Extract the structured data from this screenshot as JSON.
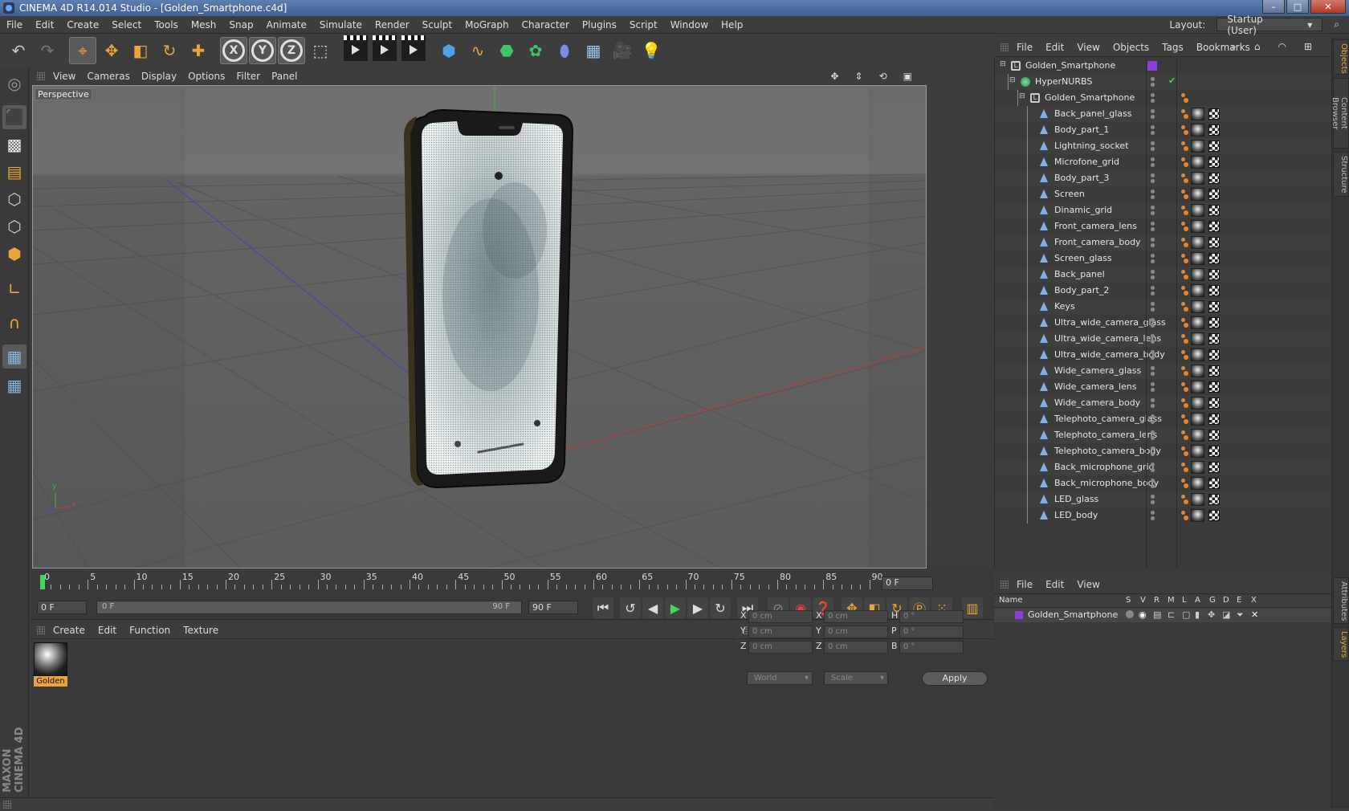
{
  "window": {
    "title": "CINEMA 4D R14.014 Studio - [Golden_Smartphone.c4d]",
    "min": "–",
    "max": "□",
    "close": "✕"
  },
  "menubar": {
    "items": [
      "File",
      "Edit",
      "Create",
      "Select",
      "Tools",
      "Mesh",
      "Snap",
      "Animate",
      "Simulate",
      "Render",
      "Sculpt",
      "MoGraph",
      "Character",
      "Plugins",
      "Script",
      "Window",
      "Help"
    ],
    "layout_label": "Layout:",
    "layout_value": "Startup (User)"
  },
  "toolbar": {
    "axis_x": "X",
    "axis_y": "Y",
    "axis_z": "Z"
  },
  "viewport": {
    "menu": [
      "View",
      "Cameras",
      "Display",
      "Options",
      "Filter",
      "Panel"
    ],
    "label": "Perspective",
    "axis_y": "y",
    "axis_x": "x"
  },
  "objects": {
    "menu": [
      "File",
      "Edit",
      "View",
      "Objects",
      "Tags",
      "Bookmarks"
    ],
    "rows": [
      {
        "name": "Golden_Smartphone",
        "level": 0,
        "type": "null"
      },
      {
        "name": "HyperNURBS",
        "level": 1,
        "type": "nurbs"
      },
      {
        "name": "Golden_Smartphone",
        "level": 2,
        "type": "null"
      },
      {
        "name": "Back_panel_glass",
        "level": 3,
        "type": "poly"
      },
      {
        "name": "Body_part_1",
        "level": 3,
        "type": "poly"
      },
      {
        "name": "Lightning_socket",
        "level": 3,
        "type": "poly"
      },
      {
        "name": "Microfone_grid",
        "level": 3,
        "type": "poly"
      },
      {
        "name": "Body_part_3",
        "level": 3,
        "type": "poly"
      },
      {
        "name": "Screen",
        "level": 3,
        "type": "poly"
      },
      {
        "name": "Dinamic_grid",
        "level": 3,
        "type": "poly"
      },
      {
        "name": "Front_camera_lens",
        "level": 3,
        "type": "poly"
      },
      {
        "name": "Front_camera_body",
        "level": 3,
        "type": "poly"
      },
      {
        "name": "Screen_glass",
        "level": 3,
        "type": "poly"
      },
      {
        "name": "Back_panel",
        "level": 3,
        "type": "poly"
      },
      {
        "name": "Body_part_2",
        "level": 3,
        "type": "poly"
      },
      {
        "name": "Keys",
        "level": 3,
        "type": "poly"
      },
      {
        "name": "Ultra_wide_camera_glass",
        "level": 3,
        "type": "poly"
      },
      {
        "name": "Ultra_wide_camera_lens",
        "level": 3,
        "type": "poly"
      },
      {
        "name": "Ultra_wide_camera_body",
        "level": 3,
        "type": "poly"
      },
      {
        "name": "Wide_camera_glass",
        "level": 3,
        "type": "poly"
      },
      {
        "name": "Wide_camera_lens",
        "level": 3,
        "type": "poly"
      },
      {
        "name": "Wide_camera_body",
        "level": 3,
        "type": "poly"
      },
      {
        "name": "Telephoto_camera_glass",
        "level": 3,
        "type": "poly"
      },
      {
        "name": "Telephoto_camera_lens",
        "level": 3,
        "type": "poly"
      },
      {
        "name": "Telephoto_camera_body",
        "level": 3,
        "type": "poly"
      },
      {
        "name": "Back_microphone_grid",
        "level": 3,
        "type": "poly"
      },
      {
        "name": "Back_microphone_body",
        "level": 3,
        "type": "poly"
      },
      {
        "name": "LED_glass",
        "level": 3,
        "type": "poly"
      },
      {
        "name": "LED_body",
        "level": 3,
        "type": "poly"
      }
    ]
  },
  "timeline": {
    "labels": [
      "0",
      "5",
      "10",
      "15",
      "20",
      "25",
      "30",
      "35",
      "40",
      "45",
      "50",
      "55",
      "60",
      "65",
      "70",
      "75",
      "80",
      "85",
      "90"
    ],
    "current": "0 F"
  },
  "transport": {
    "start": "0 F",
    "slider_left": "0 F",
    "slider_right": "90 F",
    "end": "90 F"
  },
  "materials": {
    "menu": [
      "Create",
      "Edit",
      "Function",
      "Texture"
    ],
    "items": [
      {
        "name": "Golden"
      }
    ]
  },
  "coords": {
    "hdr1": "--",
    "hdr2": "--",
    "hdr3": "--",
    "rows": [
      {
        "a": "X",
        "av": "0 cm",
        "b": "X",
        "bv": "0 cm",
        "c": "H",
        "cv": "0 °"
      },
      {
        "a": "Y",
        "av": "0 cm",
        "b": "Y",
        "bv": "0 cm",
        "c": "P",
        "cv": "0 °"
      },
      {
        "a": "Z",
        "av": "0 cm",
        "b": "Z",
        "bv": "0 cm",
        "c": "B",
        "cv": "0 °"
      }
    ],
    "mode": "World",
    "size": "Scale",
    "apply": "Apply"
  },
  "layers": {
    "menu": [
      "File",
      "Edit",
      "View"
    ],
    "columns": [
      "Name",
      "S",
      "V",
      "R",
      "M",
      "L",
      "A",
      "G",
      "D",
      "E",
      "X"
    ],
    "row": "Golden_Smartphone"
  },
  "side_tabs": [
    "Objects",
    "Content Browser",
    "Structure",
    "Attributes",
    "Layers"
  ],
  "brand": "MAXON CINEMA 4D",
  "colors": {
    "accent": "#e9a53a",
    "playhead": "#3fd85a",
    "layer_color": "#8a3fd8"
  }
}
